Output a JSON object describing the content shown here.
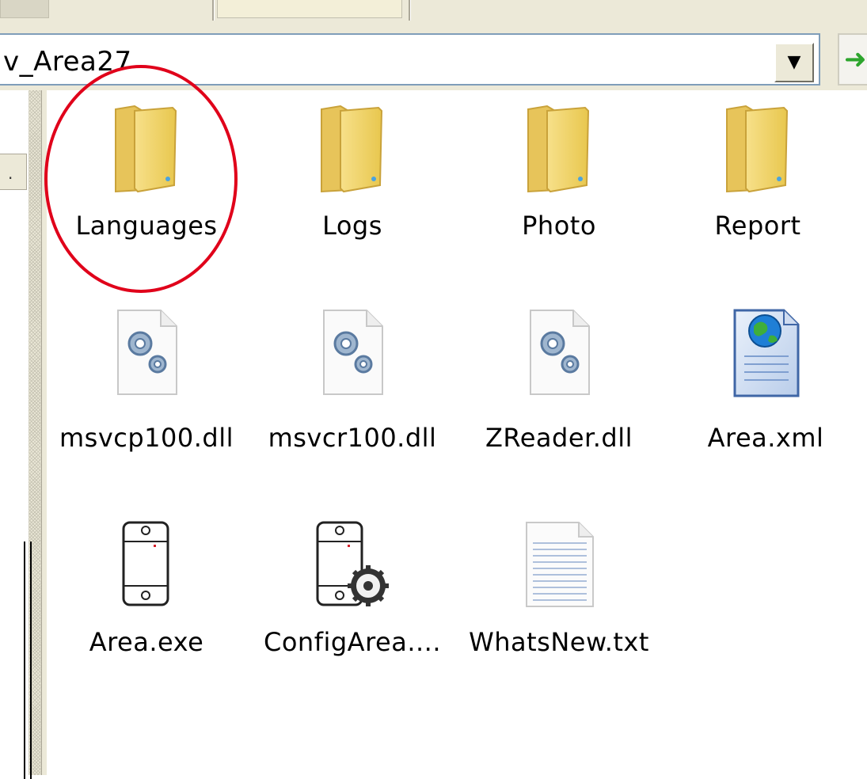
{
  "address_bar": {
    "path": "v_Area27",
    "dropdown_icon": "chevron-down-icon",
    "go_icon": "green-arrow-icon"
  },
  "left_pane": {
    "item_label": "."
  },
  "files": [
    {
      "name": "Languages",
      "icon": "folder-icon",
      "type": "folder"
    },
    {
      "name": "Logs",
      "icon": "folder-icon",
      "type": "folder"
    },
    {
      "name": "Photo",
      "icon": "folder-icon",
      "type": "folder"
    },
    {
      "name": "Report",
      "icon": "folder-icon",
      "type": "folder"
    },
    {
      "name": "msvcp100.dll",
      "icon": "dll-gear-icon",
      "type": "dll"
    },
    {
      "name": "msvcr100.dll",
      "icon": "dll-gear-icon",
      "type": "dll"
    },
    {
      "name": "ZReader.dll",
      "icon": "dll-gear-icon",
      "type": "dll"
    },
    {
      "name": "Area.xml",
      "icon": "xml-globe-icon",
      "type": "xml"
    },
    {
      "name": "Area.exe",
      "icon": "exe-device-icon",
      "type": "exe"
    },
    {
      "name": "ConfigArea....",
      "icon": "exe-config-icon",
      "type": "exe"
    },
    {
      "name": "WhatsNew.txt",
      "icon": "text-file-icon",
      "type": "txt"
    }
  ],
  "annotation": {
    "highlight_color": "#e0001a",
    "highlighted_item": "Languages"
  }
}
